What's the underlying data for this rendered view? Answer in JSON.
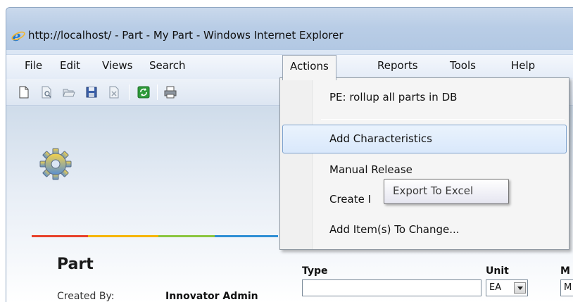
{
  "window": {
    "title": "http://localhost/ - Part - My Part - Windows Internet Explorer"
  },
  "menubar": {
    "items": [
      "File",
      "Edit",
      "Views",
      "Search",
      "Actions",
      "Reports",
      "Tools",
      "Help"
    ],
    "active": "Actions"
  },
  "actions_menu": {
    "items": [
      "PE: rollup all parts in DB",
      "Add Characteristics",
      "Manual Release",
      "Create I",
      "Add Item(s) To Change..."
    ],
    "highlighted": "Add Characteristics"
  },
  "tooltip": {
    "text": "Export To Excel"
  },
  "form": {
    "item_type": "Part",
    "created_by_label": "Created By:",
    "created_by_value": "Innovator Admin",
    "type_label": "Type",
    "type_value": "",
    "unit_label": "Unit",
    "unit_value": "EA",
    "m_label": "M",
    "m_value": "M"
  },
  "toolbar": {
    "icons": [
      "new-document-icon",
      "print-preview-icon",
      "open-folder-icon",
      "save-icon",
      "delete-icon",
      "refresh-icon",
      "print-icon"
    ]
  },
  "colors": {
    "menu_highlight_border": "#7da2ce",
    "color_bar": [
      "#e8412b",
      "#f7b500",
      "#8cc63f",
      "#2f8fd5"
    ]
  }
}
